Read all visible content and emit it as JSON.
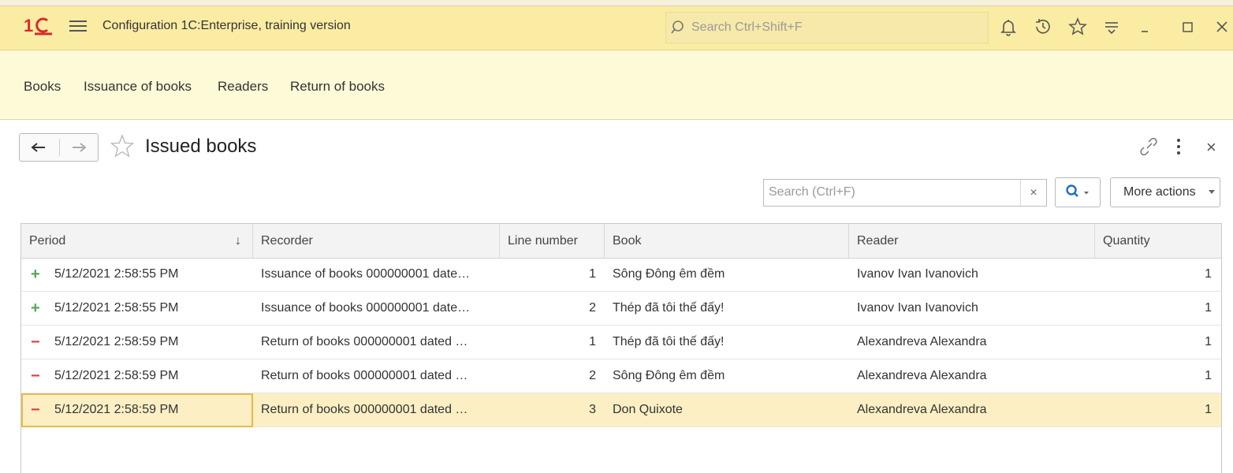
{
  "app": {
    "title": "Configuration 1C:Enterprise, training version",
    "search_placeholder": "Search Ctrl+Shift+F"
  },
  "sections": [
    "Books",
    "Issuance of books",
    "Readers",
    "Return of books"
  ],
  "form": {
    "title": "Issued books",
    "search_placeholder": "Search (Ctrl+F)",
    "clear_label": "×",
    "more_actions_label": "More actions",
    "close_label": "×"
  },
  "table": {
    "columns": {
      "period": "Period",
      "recorder": "Recorder",
      "line_number": "Line number",
      "book": "Book",
      "reader": "Reader",
      "quantity": "Quantity"
    },
    "sort_indicator": "↓",
    "rows": [
      {
        "mark": "+",
        "period": "5/12/2021 2:58:55 PM",
        "recorder": "Issuance of books 000000001 date…",
        "line_number": "1",
        "book": "Sông Đông êm đềm",
        "reader": "Ivanov Ivan Ivanovich",
        "quantity": "1"
      },
      {
        "mark": "+",
        "period": "5/12/2021 2:58:55 PM",
        "recorder": "Issuance of books 000000001 date…",
        "line_number": "2",
        "book": "Thép đã tôi thế đấy!",
        "reader": "Ivanov Ivan Ivanovich",
        "quantity": "1"
      },
      {
        "mark": "−",
        "period": "5/12/2021 2:58:59 PM",
        "recorder": "Return of books 000000001 dated …",
        "line_number": "1",
        "book": "Thép đã tôi thế đấy!",
        "reader": "Alexandreva Alexandra",
        "quantity": "1"
      },
      {
        "mark": "−",
        "period": "5/12/2021 2:58:59 PM",
        "recorder": "Return of books 000000001 dated …",
        "line_number": "2",
        "book": "Sông Đông êm đềm",
        "reader": "Alexandreva Alexandra",
        "quantity": "1"
      },
      {
        "mark": "−",
        "period": "5/12/2021 2:58:59 PM",
        "recorder": "Return of books 000000001 dated …",
        "line_number": "3",
        "book": "Don Quixote",
        "reader": "Alexandreva Alexandra",
        "quantity": "1"
      }
    ]
  },
  "colors": {
    "titlebar": "#fbeca4",
    "sections_bg": "#fdfbd7",
    "selected_row": "#fcefc4",
    "income": "#58a65a",
    "expense": "#d9414a",
    "logo": "#d62b2b"
  }
}
